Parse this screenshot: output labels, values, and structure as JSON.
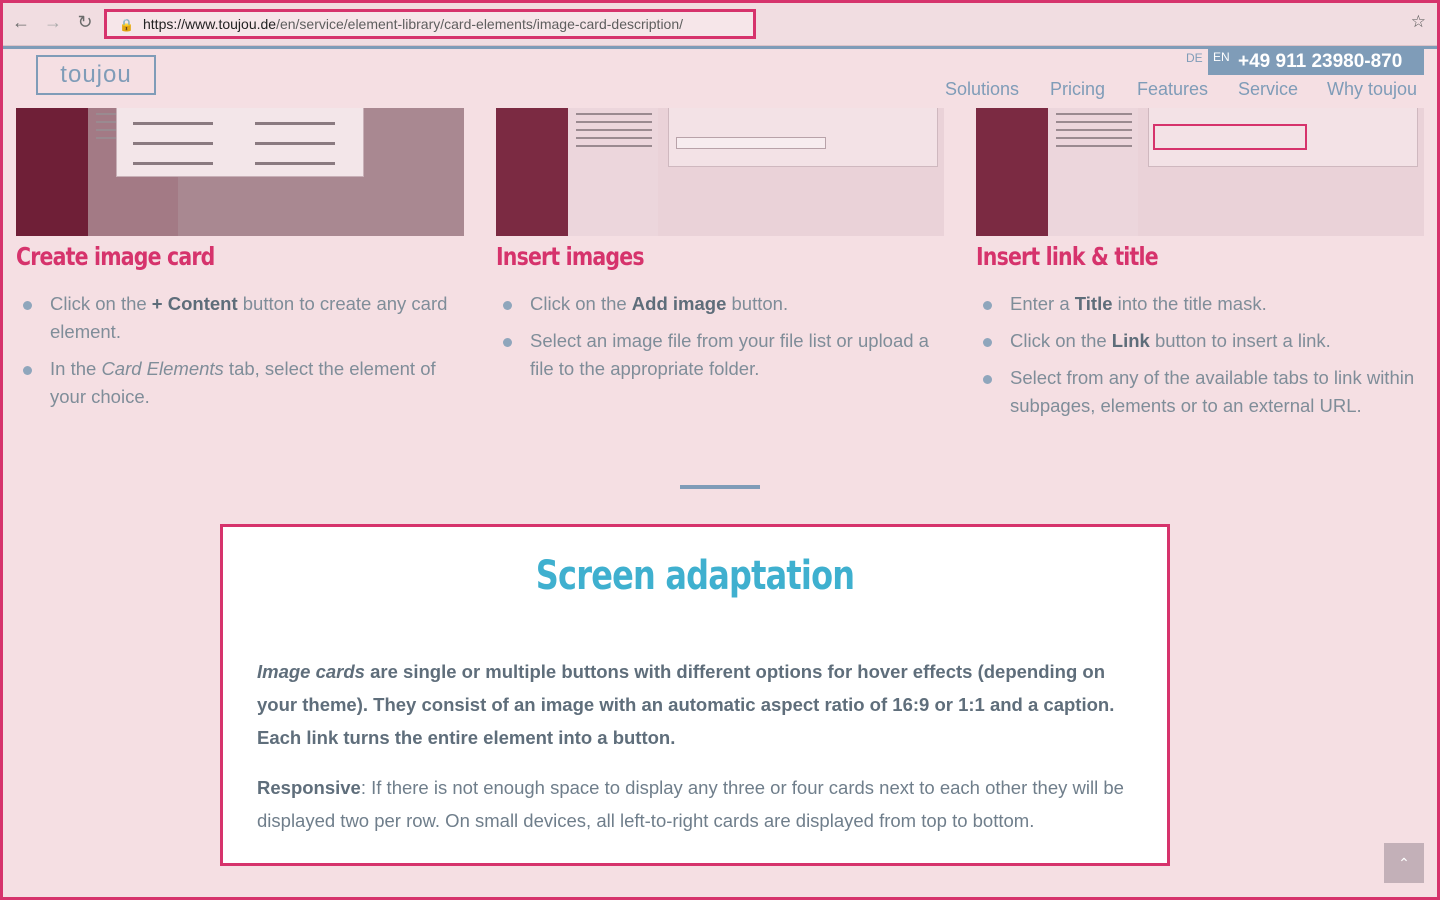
{
  "browser": {
    "url_host": "https://www.toujou.de",
    "url_path": "/en/service/element-library/card-elements/image-card-description/"
  },
  "header": {
    "logo": "toujou",
    "lang_de": "DE",
    "lang_en": "EN",
    "phone": "+49 911 23980-870",
    "menu": [
      "Solutions",
      "Pricing",
      "Features",
      "Service",
      "Why toujou"
    ]
  },
  "columns": [
    {
      "title": "Create image card",
      "items": [
        {
          "pre": "Click on the ",
          "bold": "+ Content",
          "post": " button to create any card element."
        },
        {
          "pre": "In the ",
          "italic": "Card Elements",
          "post": " tab, select the element of your choice."
        }
      ]
    },
    {
      "title": "Insert images",
      "items": [
        {
          "pre": "Click on the ",
          "bold": "Add image",
          "post": " button."
        },
        {
          "pre": "Select an image file from your file list or upload a file to the appropriate folder."
        }
      ]
    },
    {
      "title": "Insert link & title",
      "items": [
        {
          "pre": "Enter a ",
          "bold": "Title",
          "post": " into the title mask."
        },
        {
          "pre": "Click on the ",
          "bold": "Link",
          "post": " button to insert a link."
        },
        {
          "pre": "Select from any of the available tabs to link within subpages, elements or to an external URL."
        }
      ]
    }
  ],
  "info": {
    "title": "Screen adaptation",
    "p1_italic": "Image cards",
    "p1_rest": " are single or multiple buttons with different options for hover effects (depending on your theme). They consist of an image with an automatic aspect ratio of 16:9 or 1:1 and a caption. Each link turns the entire element into a button.",
    "p2_bold": "Responsive",
    "p2_rest": ": If there is not enough space to display any three or four cards next to each other they will be displayed two per row. On small devices, all left-to-right cards are displayed from top to bottom."
  }
}
